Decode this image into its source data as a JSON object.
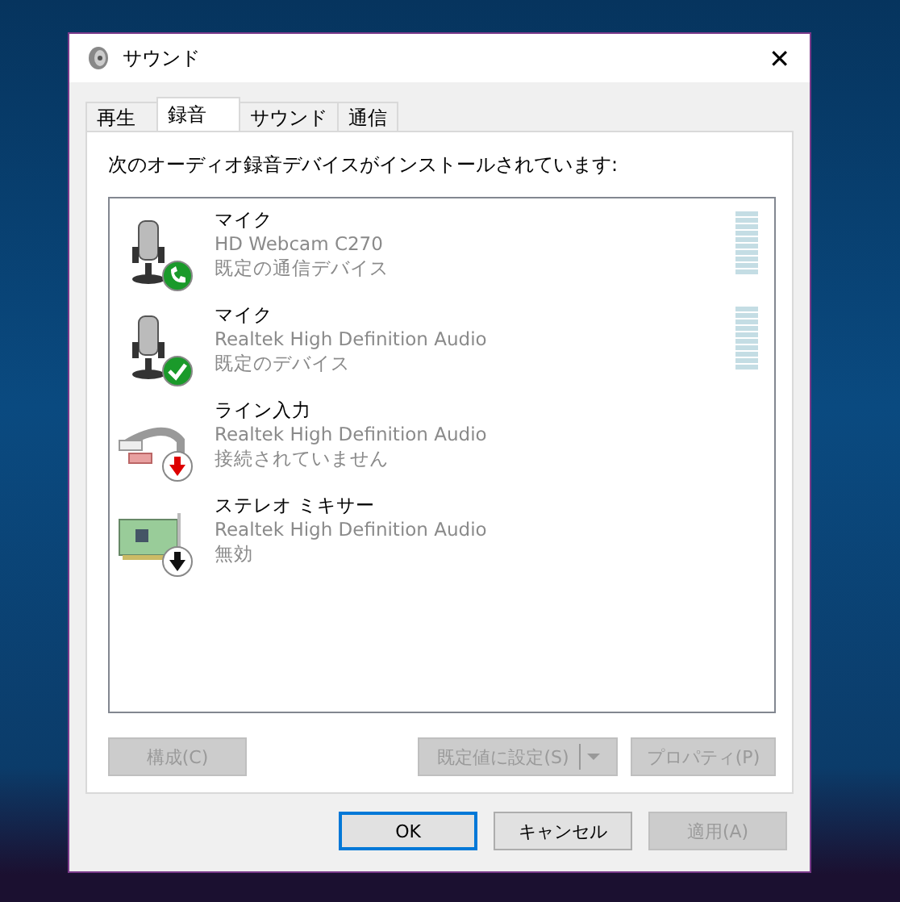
{
  "window": {
    "title": "サウンド",
    "close": "✕"
  },
  "tabs": [
    {
      "label": "再生",
      "selected": false
    },
    {
      "label": "録音",
      "selected": true
    },
    {
      "label": "サウンド",
      "selected": false
    },
    {
      "label": "通信",
      "selected": false
    }
  ],
  "instruction": "次のオーディオ録音デバイスがインストールされています:",
  "devices": [
    {
      "kind": "mic",
      "badge": {
        "kind": "phone"
      },
      "name": "マイク",
      "driver": "HD Webcam C270",
      "status": "既定の通信デバイス",
      "meter": true
    },
    {
      "kind": "mic",
      "badge": {
        "kind": "check"
      },
      "name": "マイク",
      "driver": "Realtek High Definition Audio",
      "status": "既定のデバイス",
      "meter": true
    },
    {
      "kind": "line",
      "badge": {
        "kind": "unplugged"
      },
      "name": "ライン入力",
      "driver": "Realtek High Definition Audio",
      "status": "接続されていません",
      "meter": false
    },
    {
      "kind": "card",
      "badge": {
        "kind": "disabled"
      },
      "name": "ステレオ ミキサー",
      "driver": "Realtek High Definition Audio",
      "status": "無効",
      "meter": false
    }
  ],
  "panel_buttons": [
    {
      "kind": "plain",
      "label": "構成(C)",
      "disabled": true
    },
    {
      "kind": "split",
      "label": "既定値に設定(S)",
      "disabled": true
    },
    {
      "kind": "plain",
      "label": "プロパティ(P)",
      "disabled": true
    }
  ],
  "dialog_buttons": [
    {
      "label": "OK",
      "disabled": false,
      "default": true
    },
    {
      "label": "キャンセル",
      "disabled": false,
      "default": false
    },
    {
      "label": "適用(A)",
      "disabled": true,
      "default": false
    }
  ]
}
